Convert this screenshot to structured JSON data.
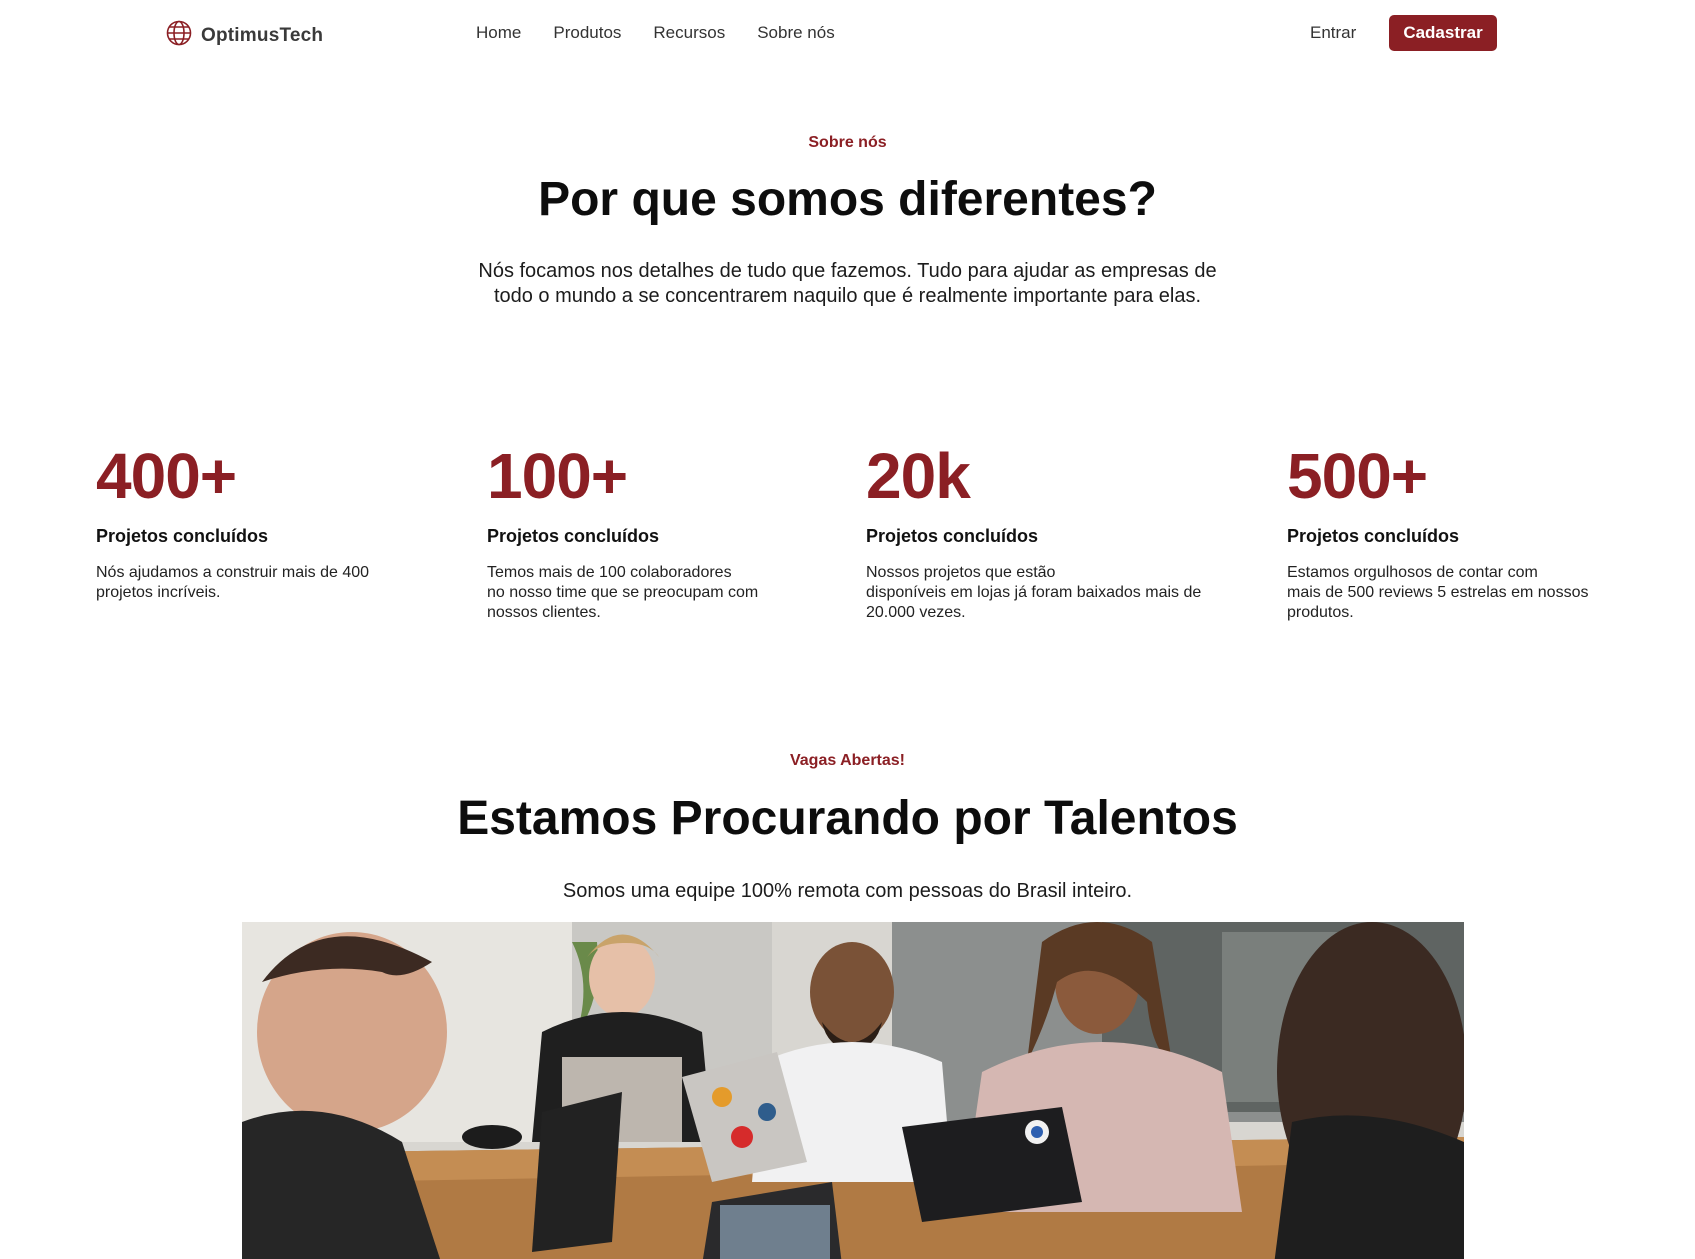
{
  "nav": {
    "brand": "OptimusTech",
    "links": [
      "Home",
      "Produtos",
      "Recursos",
      "Sobre nós"
    ],
    "login": "Entrar",
    "signup": "Cadastrar"
  },
  "about": {
    "eyebrow": "Sobre nós",
    "title": "Por que somos diferentes?",
    "lead_line1": "Nós focamos nos detalhes de tudo que fazemos. Tudo para ajudar as empresas de",
    "lead_line2": "todo o mundo a se concentrarem naquilo que é realmente importante para elas."
  },
  "stats": [
    {
      "number": "400+",
      "title": "Projetos concluídos",
      "desc": "Nós ajudamos a construir mais de 400\nprojetos incríveis."
    },
    {
      "number": "100+",
      "title": "Projetos concluídos",
      "desc": "Temos mais de 100 colaboradores\nno nosso time que se preocupam com\nnossos clientes."
    },
    {
      "number": "20k",
      "title": "Projetos concluídos",
      "desc": "Nossos projetos que estão\ndisponíveis em lojas já foram baixados mais de\n20.000 vezes."
    },
    {
      "number": "500+",
      "title": "Projetos concluídos",
      "desc": "Estamos orgulhosos de contar com\nmais de 500 reviews 5 estrelas em nossos\nprodutos."
    }
  ],
  "careers": {
    "eyebrow": "Vagas Abertas!",
    "title": "Estamos Procurando por Talentos",
    "lead": "Somos uma equipe 100% remota com pessoas do Brasil inteiro."
  },
  "colors": {
    "accent": "#8b1f24"
  },
  "icons": {
    "logo": "globe-icon"
  }
}
